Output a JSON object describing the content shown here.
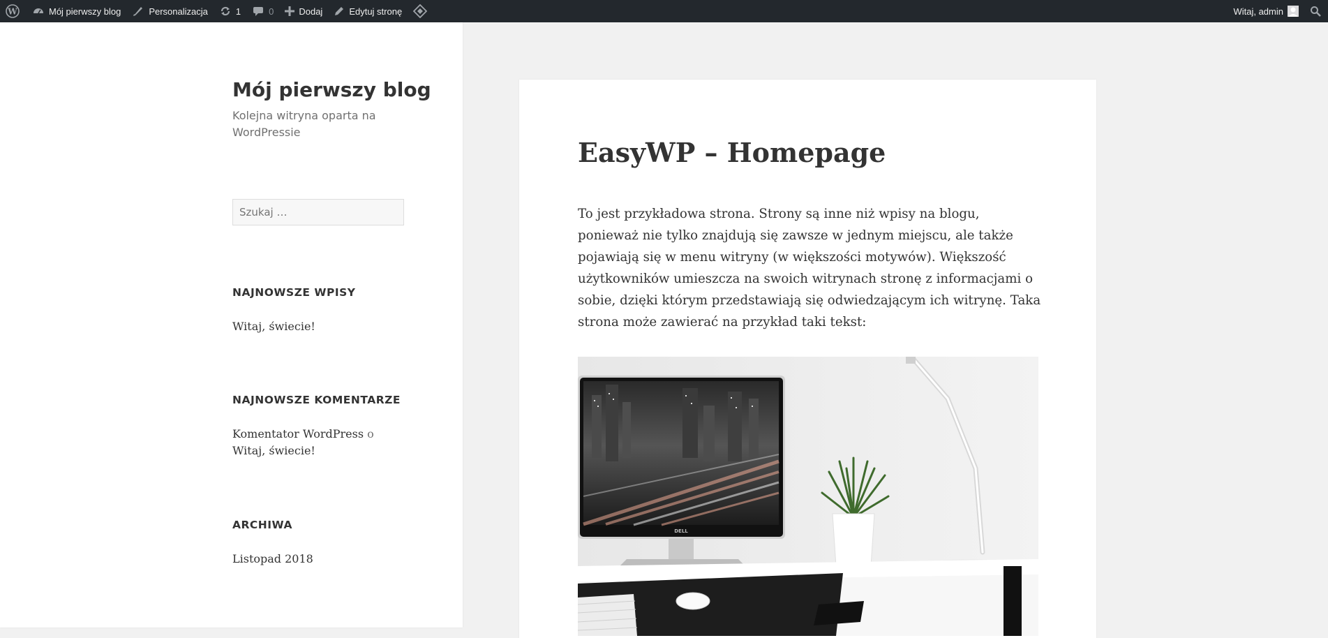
{
  "admin_bar": {
    "wp_logo_icon": "wordpress-icon",
    "site_name": "Mój pierwszy blog",
    "customize": "Personalizacja",
    "updates_count": "1",
    "comments_count": "0",
    "new_label": "Dodaj",
    "edit_page": "Edytuj stronę",
    "greeting": "Witaj, admin"
  },
  "sidebar": {
    "site_title": "Mój pierwszy blog",
    "site_description": "Kolejna witryna oparta na WordPressie",
    "search_placeholder": "Szukaj …",
    "widgets": {
      "recent_posts": {
        "title": "NAJNOWSZE WPISY",
        "items": [
          "Witaj, świecie!"
        ]
      },
      "recent_comments": {
        "title": "NAJNOWSZE KOMENTARZE",
        "author": "Komentator WordPress",
        "connector": "o",
        "post": "Witaj, świecie!"
      },
      "archives": {
        "title": "ARCHIWA",
        "items": [
          "Listopad 2018"
        ]
      }
    }
  },
  "main": {
    "title": "EasyWP – Homepage",
    "paragraph": "To jest przykładowa strona. Strony są inne niż wpisy na blogu, ponieważ nie tylko znajdują się zawsze w jednym miejscu, ale także pojawiają się w menu witryny (w większości motywów). Większość użytkowników umieszcza na swoich witrynach stronę z informacjami o sobie, dzięki którym przedstawiają się odwiedzającym ich witrynę. Taka strona może zawierać na przykład taki tekst:",
    "monitor_brand": "DELL"
  },
  "colors": {
    "admin_bar": "#23282d",
    "background": "#f1f1f1",
    "text": "#333333",
    "muted": "#707070"
  }
}
